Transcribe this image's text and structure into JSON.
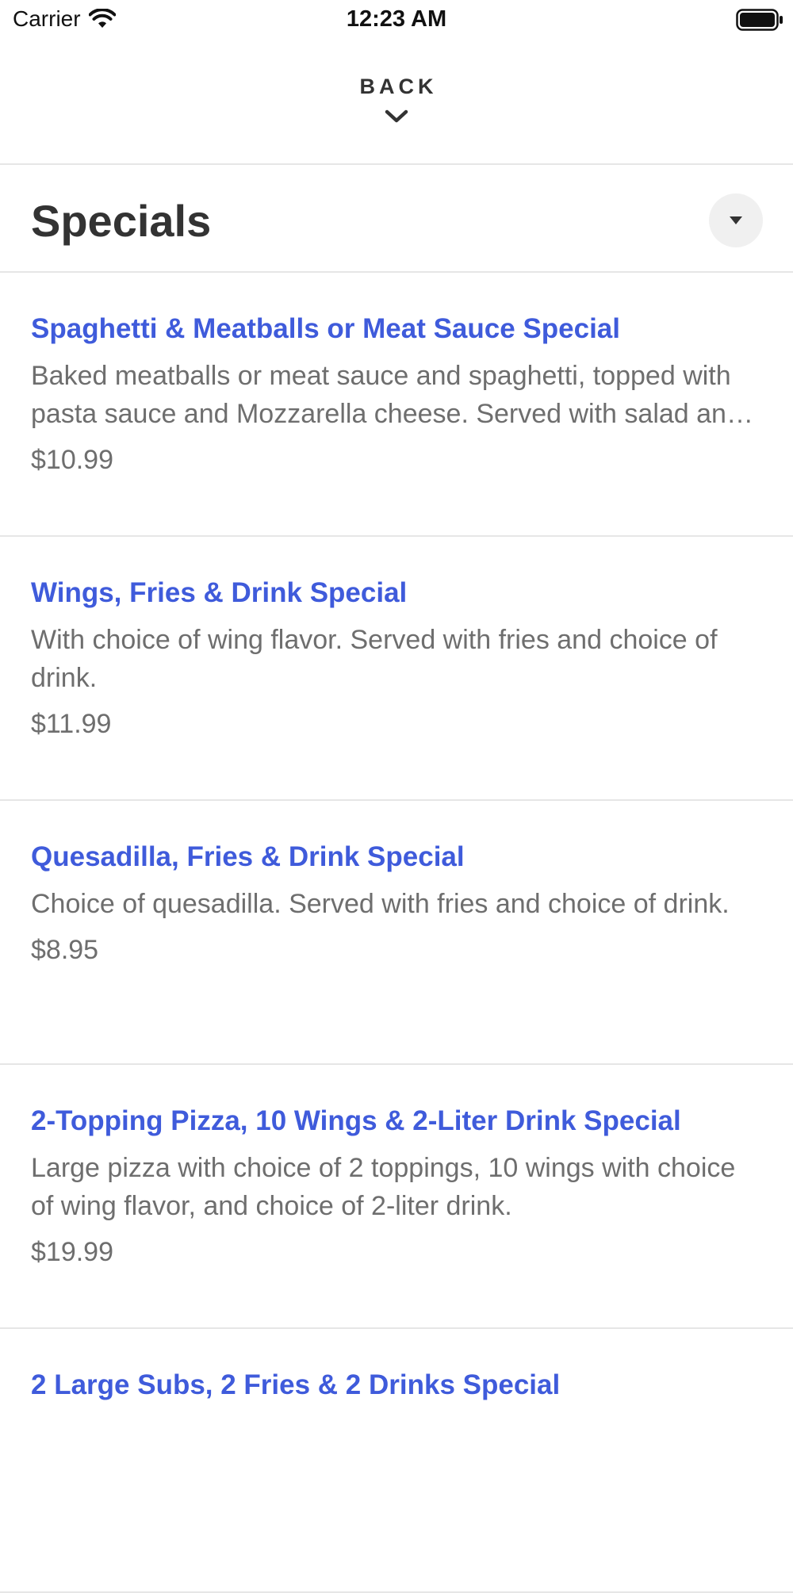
{
  "status_bar": {
    "carrier": "Carrier",
    "time": "12:23 AM",
    "icons": [
      "wifi-icon",
      "battery-icon"
    ]
  },
  "header": {
    "back_label": "BACK",
    "back_icon": "chevron-down-icon"
  },
  "section": {
    "title": "Specials",
    "toggle_icon": "caret-down-icon"
  },
  "colors": {
    "item_name": "#3f5bdb",
    "body_text": "#6e6e6e",
    "title_text": "#333333",
    "divider": "#e6e6e6",
    "toggle_bg": "#f0f0f0"
  },
  "menu_items": [
    {
      "name": "Spaghetti & Meatballs or Meat Sauce Special",
      "description": "Baked meatballs or meat sauce and spaghetti, topped with pasta sauce and Mozzarella cheese. Served with salad an…",
      "price": "$10.99"
    },
    {
      "name": "Wings, Fries & Drink Special",
      "description": "With choice of wing flavor. Served with fries and choice of drink.",
      "price": "$11.99"
    },
    {
      "name": "Quesadilla, Fries & Drink Special",
      "description": "Choice of quesadilla. Served with fries and choice of drink.",
      "price": "$8.95"
    },
    {
      "name": "2-Topping Pizza, 10 Wings & 2-Liter Drink Special",
      "description": "Large pizza with choice of 2 toppings, 10 wings with choice of wing flavor, and choice of 2-liter drink.",
      "price": "$19.99"
    },
    {
      "name": "2 Large Subs, 2 Fries & 2 Drinks Special",
      "description": "",
      "price": ""
    }
  ]
}
